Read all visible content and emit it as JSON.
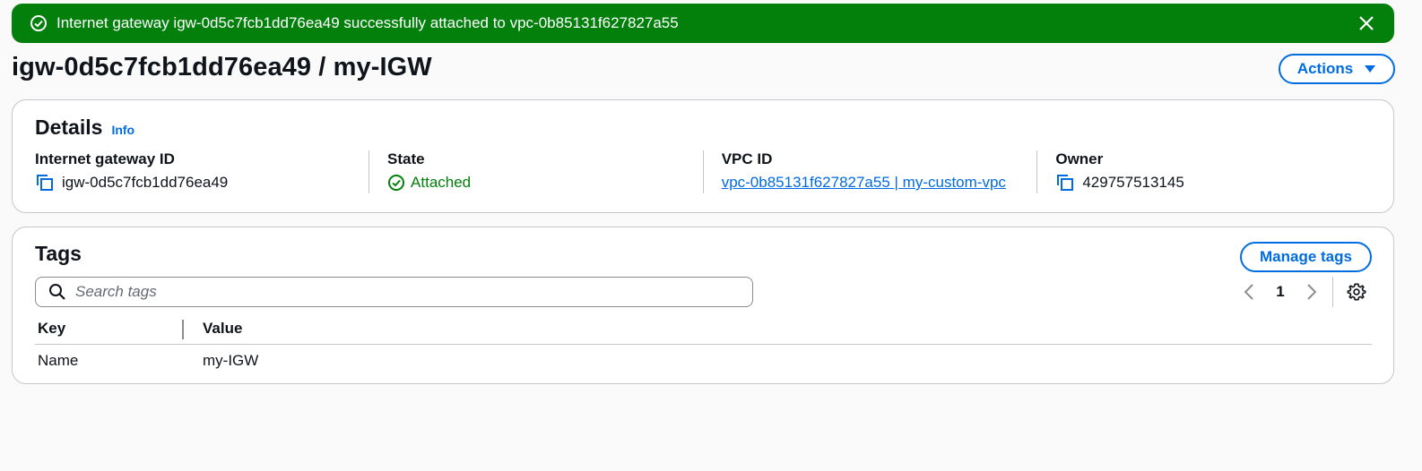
{
  "flash": {
    "message": "Internet gateway igw-0d5c7fcb1dd76ea49 successfully attached to vpc-0b85131f627827a55",
    "type": "success",
    "color": "#037f0c"
  },
  "header": {
    "title": "igw-0d5c7fcb1dd76ea49 / my-IGW",
    "actions_label": "Actions"
  },
  "details": {
    "heading": "Details",
    "info_label": "Info",
    "fields": [
      {
        "label": "Internet gateway ID",
        "value": "igw-0d5c7fcb1dd76ea49",
        "icon": "copy-icon"
      },
      {
        "label": "State",
        "value": "Attached",
        "icon": "check-circle-icon"
      },
      {
        "label": "VPC ID",
        "value": "vpc-0b85131f627827a55 | my-custom-vpc"
      },
      {
        "label": "Owner",
        "value": "429757513145",
        "icon": "copy-icon"
      }
    ]
  },
  "tags": {
    "heading": "Tags",
    "manage_label": "Manage tags",
    "search_placeholder": "Search tags",
    "page": "1",
    "columns": [
      "Key",
      "Value"
    ],
    "rows": [
      {
        "key": "Name",
        "value": "my-IGW"
      }
    ]
  },
  "colors": {
    "accent": "#006ce0",
    "success": "#037f0c",
    "border": "#c6c6cd"
  }
}
